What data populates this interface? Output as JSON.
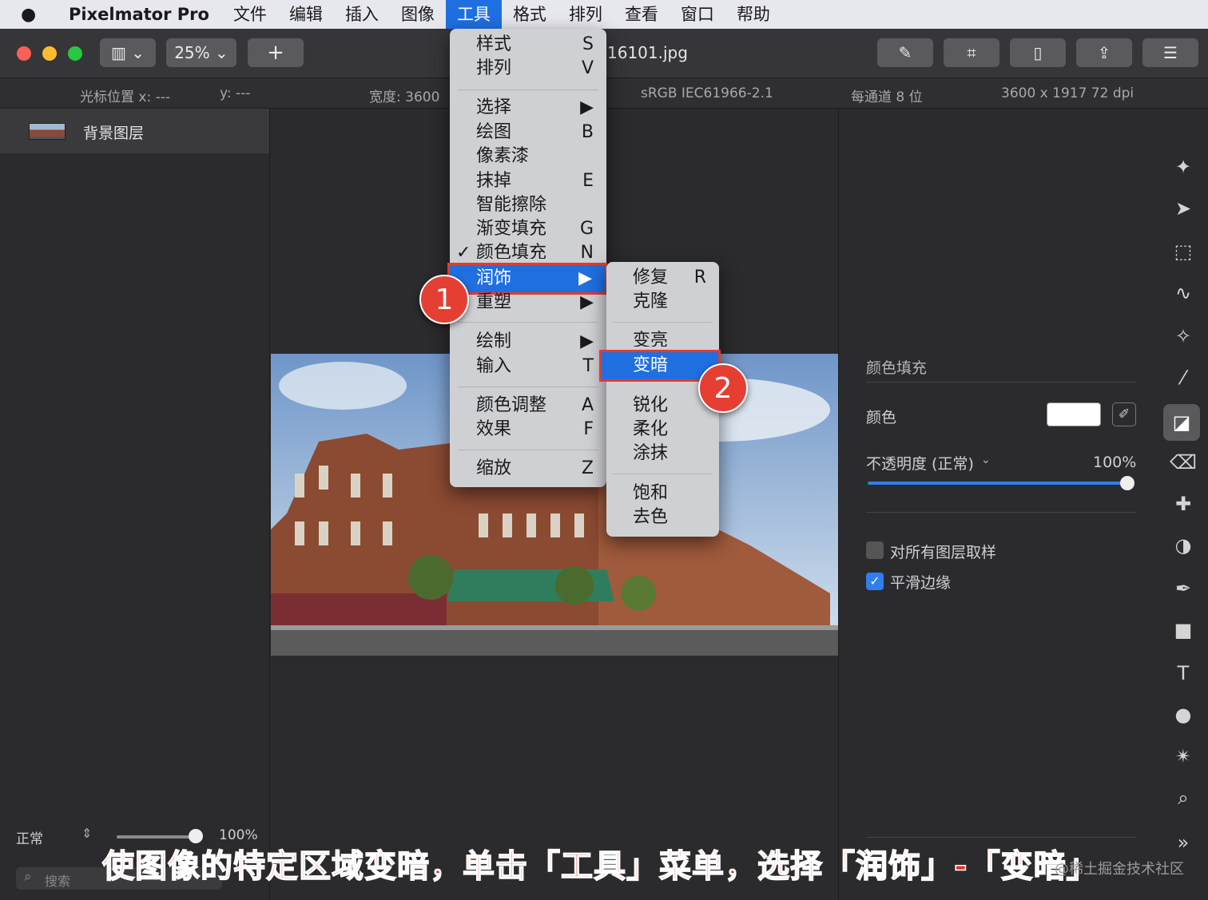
{
  "menubar": {
    "app_name": "Pixelmator Pro",
    "items": [
      "文件",
      "编辑",
      "插入",
      "图像",
      "工具",
      "格式",
      "排列",
      "查看",
      "窗口",
      "帮助"
    ],
    "active_item": "工具"
  },
  "toolbar": {
    "zoom": "25%",
    "add_label": "+",
    "doc_title": "16101.jpg"
  },
  "infobar": {
    "cursor_x": "光标位置 x:  ---",
    "cursor_y": "y:  ---",
    "width": "宽度:  3600",
    "color_profile": "sRGB IEC61966-2.1",
    "bit_depth": "每通道 8 位",
    "dimensions": "3600 x 1917 72 dpi"
  },
  "sidebar": {
    "layer_name": "背景图层",
    "blend_mode": "正常",
    "opacity": "100%",
    "search_placeholder": "搜索"
  },
  "tools_menu": {
    "items": [
      {
        "label": "样式",
        "shortcut": "S"
      },
      {
        "label": "排列",
        "shortcut": "V"
      },
      {
        "label": "选择",
        "shortcut": "▶"
      },
      {
        "label": "绘图",
        "shortcut": "B"
      },
      {
        "label": "像素漆",
        "shortcut": ""
      },
      {
        "label": "抹掉",
        "shortcut": "E"
      },
      {
        "label": "智能擦除",
        "shortcut": ""
      },
      {
        "label": "渐变填充",
        "shortcut": "G"
      },
      {
        "label": "颜色填充",
        "shortcut": "N",
        "check": "✓"
      },
      {
        "label": "润饰",
        "shortcut": "▶"
      },
      {
        "label": "重塑",
        "shortcut": "▶"
      },
      {
        "label": "绘制",
        "shortcut": "▶"
      },
      {
        "label": "输入",
        "shortcut": "T"
      },
      {
        "label": "颜色调整",
        "shortcut": "A"
      },
      {
        "label": "效果",
        "shortcut": "F"
      },
      {
        "label": "缩放",
        "shortcut": "Z"
      }
    ]
  },
  "retouch_submenu": {
    "items": [
      {
        "label": "修复",
        "shortcut": "R"
      },
      {
        "label": "克隆",
        "shortcut": ""
      },
      {
        "label": "变亮",
        "shortcut": ""
      },
      {
        "label": "变暗",
        "shortcut": ""
      },
      {
        "label": "锐化",
        "shortcut": ""
      },
      {
        "label": "柔化",
        "shortcut": ""
      },
      {
        "label": "涂抹",
        "shortcut": ""
      },
      {
        "label": "饱和",
        "shortcut": ""
      },
      {
        "label": "去色",
        "shortcut": ""
      }
    ]
  },
  "right_panel": {
    "section_title": "颜色填充",
    "color_label": "颜色",
    "color_value": "#ffffff",
    "opacity_label": "不透明度 (正常)",
    "opacity_value": "100%",
    "sample_all_label": "对所有图层取样",
    "sample_all_checked": false,
    "smooth_edges_label": "平滑边缘",
    "smooth_edges_checked": true,
    "more_label": "»"
  },
  "badges": [
    "1",
    "2"
  ],
  "caption": "使图像的特定区域变暗，单击「工具」菜单，选择「润饰」-「变暗」",
  "watermark": "@稀土掘金技术社区",
  "colors": {
    "accent": "#1f6fe0",
    "highlight_border": "#e23b2f",
    "badge": "#e53f33",
    "menubar": "#e7e8ee"
  }
}
